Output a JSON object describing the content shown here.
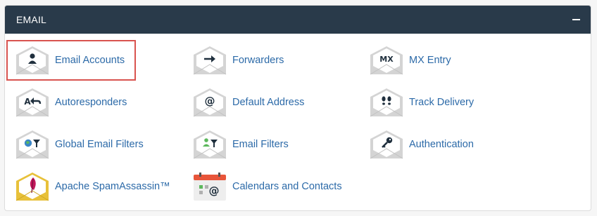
{
  "panel": {
    "title": "EMAIL"
  },
  "items": [
    {
      "label": "Email Accounts",
      "icon": "user-envelope-icon"
    },
    {
      "label": "Forwarders",
      "icon": "arrow-envelope-icon"
    },
    {
      "label": "MX Entry",
      "icon": "mx-envelope-icon"
    },
    {
      "label": "Autoresponders",
      "icon": "reply-envelope-icon"
    },
    {
      "label": "Default Address",
      "icon": "at-envelope-icon"
    },
    {
      "label": "Track Delivery",
      "icon": "footprints-envelope-icon"
    },
    {
      "label": "Global Email Filters",
      "icon": "globe-filter-envelope-icon"
    },
    {
      "label": "Email Filters",
      "icon": "user-filter-envelope-icon"
    },
    {
      "label": "Authentication",
      "icon": "key-envelope-icon"
    },
    {
      "label": "Apache SpamAssassin™",
      "icon": "feather-envelope-icon"
    },
    {
      "label": "Calendars and Contacts",
      "icon": "calendar-contacts-icon"
    }
  ],
  "colors": {
    "header_bg": "#293a4a",
    "link": "#2c6aa8",
    "selection_outline": "#d9534f",
    "envelope": "#d4d4d4",
    "spamassassin_envelope": "#e8c13a",
    "calendar_accent": "#e8553a"
  }
}
